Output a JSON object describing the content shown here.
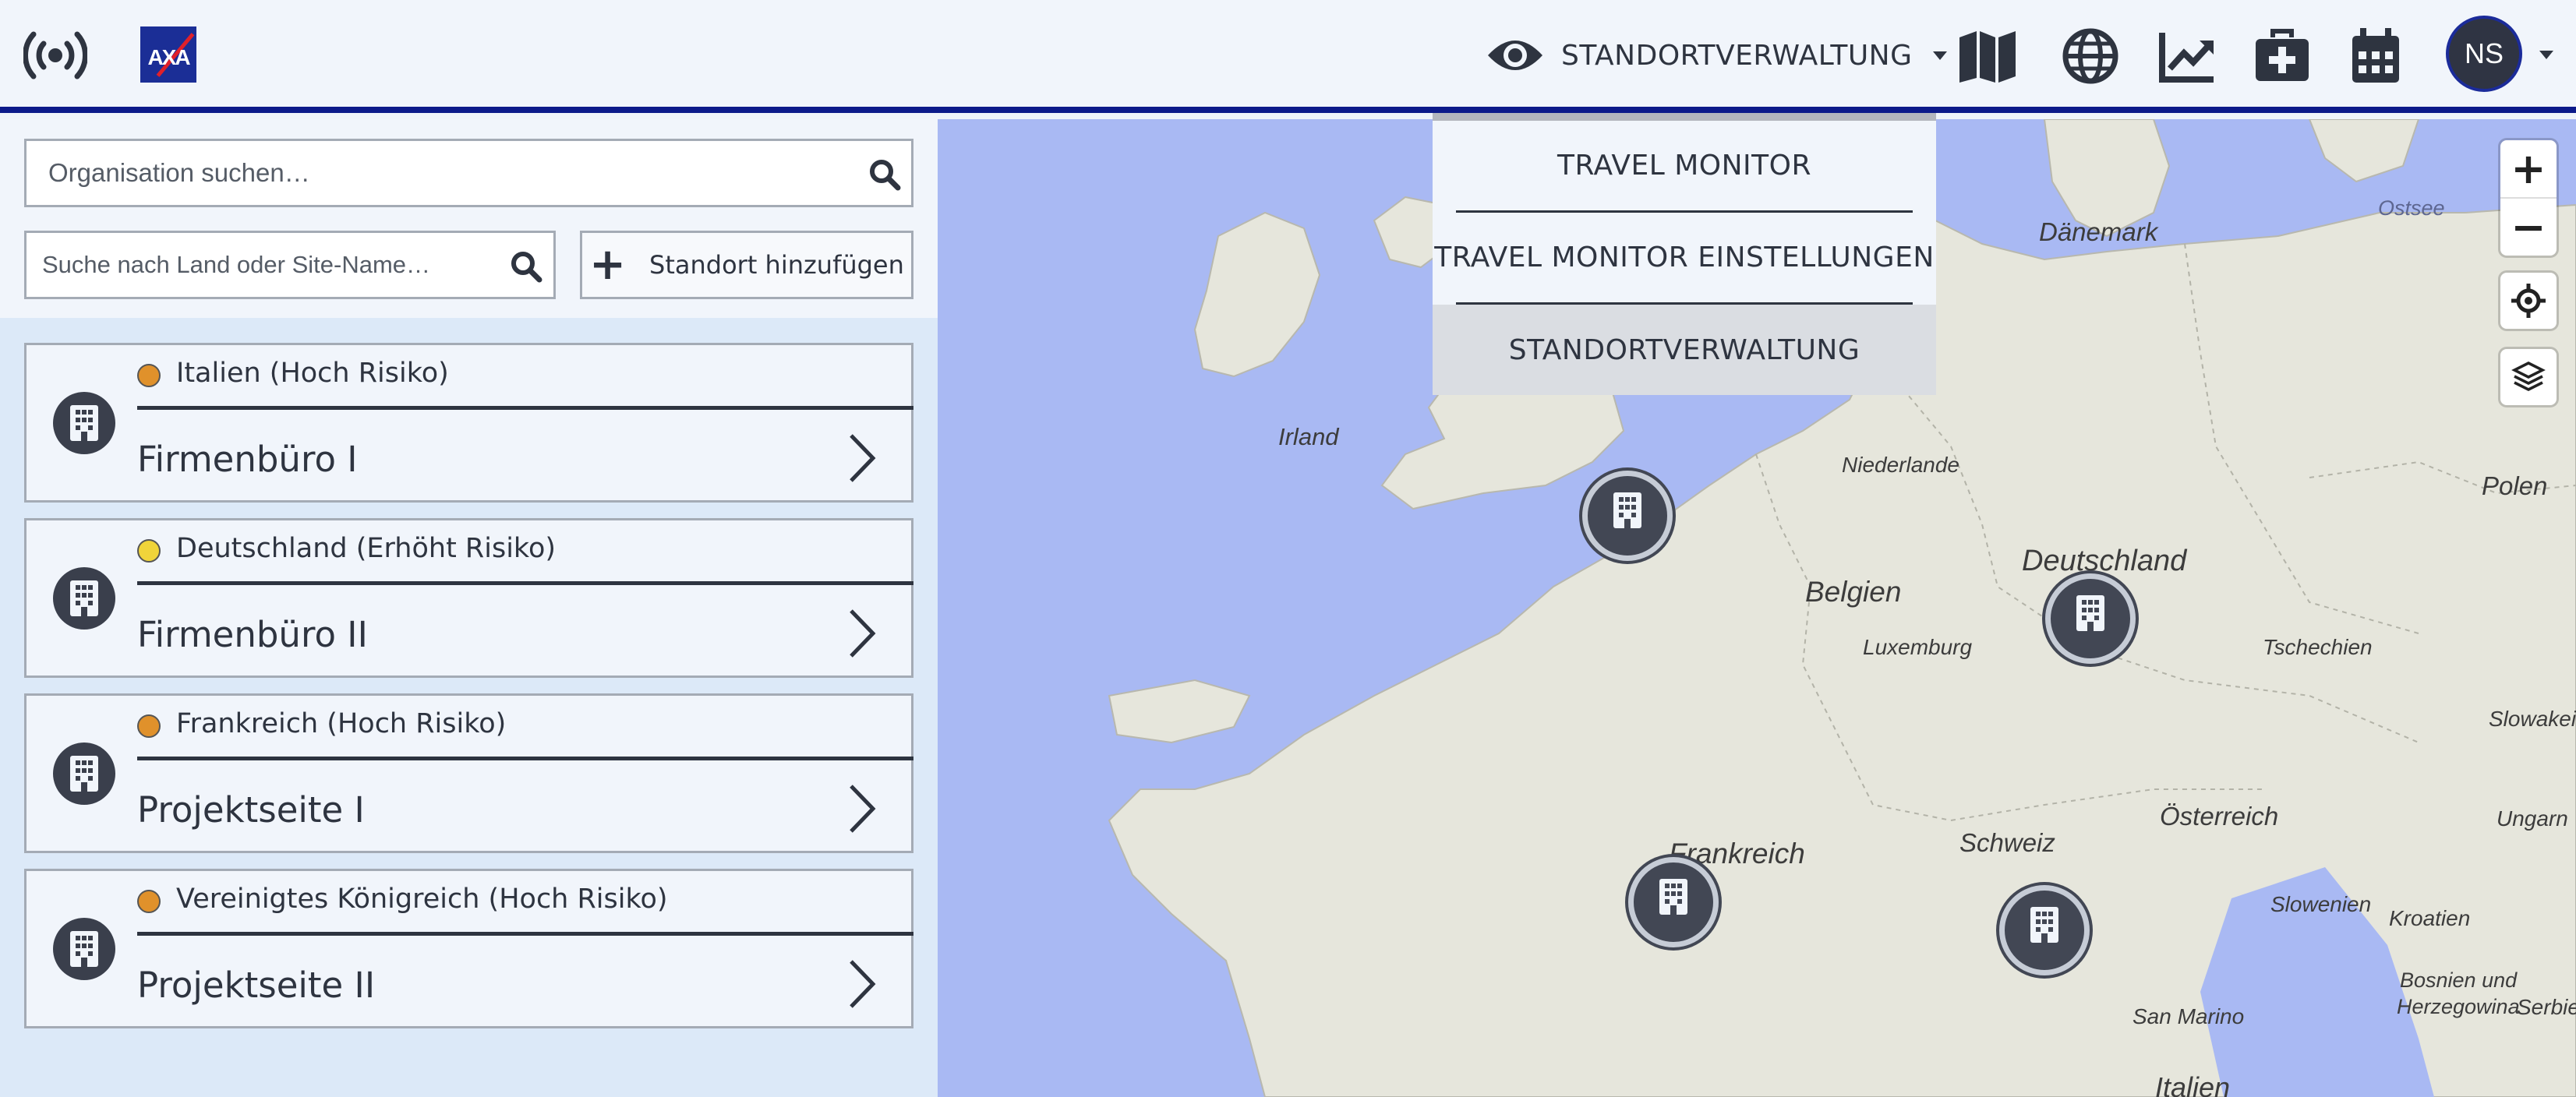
{
  "header": {
    "broadcast_icon": "broadcast-icon",
    "logo_text": "AXA",
    "view_menu": {
      "icon": "eye-icon",
      "label": "STANDORTVERWALTUNG"
    },
    "icons": [
      "map-icon",
      "globe-icon",
      "chart-line-icon",
      "medical-kit-icon",
      "calendar-icon"
    ],
    "avatar_initials": "NS"
  },
  "dropdown": {
    "items": [
      {
        "label": "TRAVEL MONITOR"
      },
      {
        "label": "TRAVEL MONITOR EINSTELLUNGEN"
      },
      {
        "label": "STANDORTVERWALTUNG"
      }
    ]
  },
  "sidebar": {
    "org_search_placeholder": "Organisation suchen…",
    "site_search_placeholder": "Suche nach Land oder Site-Name…",
    "add_site_label": "Standort hinzufügen",
    "sites": [
      {
        "country": "Italien (Hoch Risiko)",
        "name": "Firmenbüro I",
        "risk_color": "#e0912b"
      },
      {
        "country": "Deutschland (Erhöht Risiko)",
        "name": "Firmenbüro II",
        "risk_color": "#f0d43a"
      },
      {
        "country": "Frankreich (Hoch Risiko)",
        "name": "Projektseite I",
        "risk_color": "#e0912b"
      },
      {
        "country": "Vereinigtes Königreich (Hoch Risiko)",
        "name": "Projektseite II",
        "risk_color": "#e0912b"
      }
    ]
  },
  "map": {
    "labels": {
      "ostsee": "Ostsee",
      "daenemark": "Dänemark",
      "irland": "Irland",
      "niederlande": "Niederlande",
      "polen": "Polen",
      "belgien": "Belgien",
      "deutschland": "Deutschland",
      "luxemburg": "Luxemburg",
      "tschechien": "Tschechien",
      "slowakei": "Slowakei",
      "frankreich": "Frankreich",
      "oesterreich": "Österreich",
      "schweiz": "Schweiz",
      "ungarn": "Ungarn",
      "slowenien": "Slowenien",
      "kroatien": "Kroatien",
      "bosnien": "Bosnien und",
      "herzegowina": "Herzegowina",
      "serbien": "Serbien",
      "san_marino": "San Marino",
      "italien": "Italien"
    },
    "controls": [
      "zoom-in",
      "zoom-out",
      "locate-icon",
      "layers-icon"
    ]
  },
  "colors": {
    "accent": "#0c1a8a",
    "water": "#a9b9f3",
    "land": "#e6e6dc",
    "high_risk": "#e0912b",
    "elevated_risk": "#f0d43a"
  }
}
